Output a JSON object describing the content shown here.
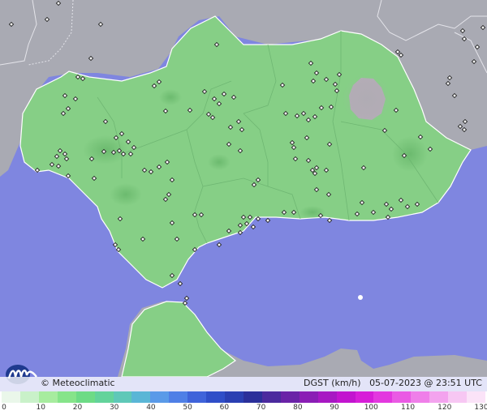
{
  "credit": "© Meteoclimatic",
  "caption": {
    "variable": "DGST (km/h)",
    "datetime": "05-07-2023 @ 23:51 UTC"
  },
  "scale": {
    "labels": [
      "0",
      "10",
      "20",
      "30",
      "40",
      "50",
      "60",
      "70",
      "80",
      "90",
      "100",
      "110",
      "120",
      "130"
    ],
    "colors": [
      "#eaf7ea",
      "#c9f1c9",
      "#a7ec9f",
      "#86e48a",
      "#6ddb86",
      "#63d39b",
      "#5fc8b8",
      "#5ab6d6",
      "#5a9ae8",
      "#4f7fe6",
      "#3f63da",
      "#2f4ec8",
      "#2a3fb2",
      "#2b2f9a",
      "#4b2a9e",
      "#6a23a7",
      "#8a1eb5",
      "#a718c3",
      "#c214cf",
      "#d71ed8",
      "#e338df",
      "#ea5ae4",
      "#ef7fe9",
      "#f3a3ee",
      "#f7c7f3",
      "#fbe3f8"
    ]
  },
  "colors": {
    "sea": "#7f86e0",
    "land_foreign": "#a7a9b3",
    "region": "#86cf86",
    "footer": "#ffffff"
  },
  "icons": {
    "logo": "meteoclimatic-logo",
    "station": "station-marker"
  }
}
